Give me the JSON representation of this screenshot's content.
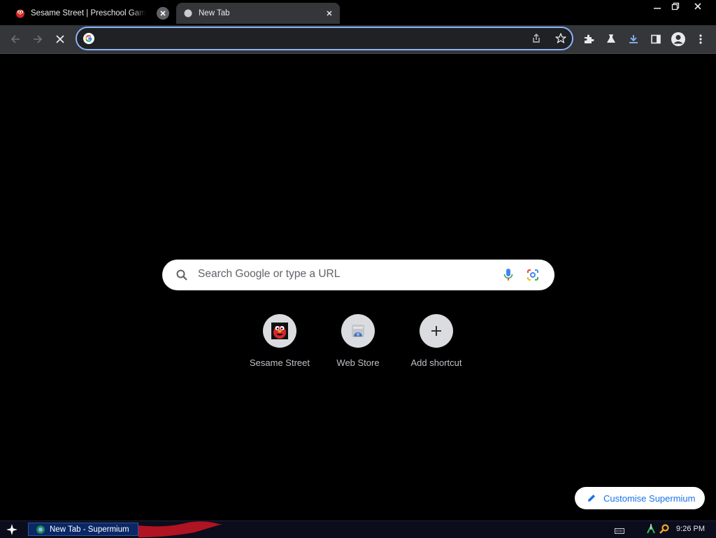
{
  "browser": {
    "tabs": [
      {
        "title": "Sesame Street | Preschool Games, Videos & More",
        "active": false
      },
      {
        "title": "New Tab",
        "active": true
      }
    ],
    "window_controls": [
      "minimize-icon",
      "restore-icon",
      "close-icon"
    ],
    "toolbar": {
      "omnibox_value": "",
      "icons": [
        "back-arrow-icon",
        "forward-arrow-icon",
        "stop-loading-icon",
        "share-icon",
        "bookmark-star-icon",
        "extensions-puzzle-icon",
        "labs-flask-icon",
        "download-icon",
        "side-panel-icon",
        "profile-avatar-icon",
        "more-menu-icon"
      ]
    }
  },
  "newtab": {
    "search_placeholder": "Search Google or type a URL",
    "shortcuts": [
      {
        "label": "Sesame Street",
        "icon": "elmo-favicon"
      },
      {
        "label": "Web Store",
        "icon": "web-store-icon"
      },
      {
        "label": "Add shortcut",
        "icon": "plus-icon"
      }
    ],
    "customise_label": "Customise Supermium"
  },
  "taskbar": {
    "start_icon": "star-start-icon",
    "task_label": "New Tab - Supermium",
    "tray_icons": [
      "keyboard-icon",
      "network-icon",
      "search-icon"
    ],
    "clock": "9:26 PM"
  },
  "colors": {
    "accent": "#8ab4f8",
    "toolbar": "#35363a",
    "page_bg": "#000000",
    "link_blue": "#1a73e8"
  }
}
